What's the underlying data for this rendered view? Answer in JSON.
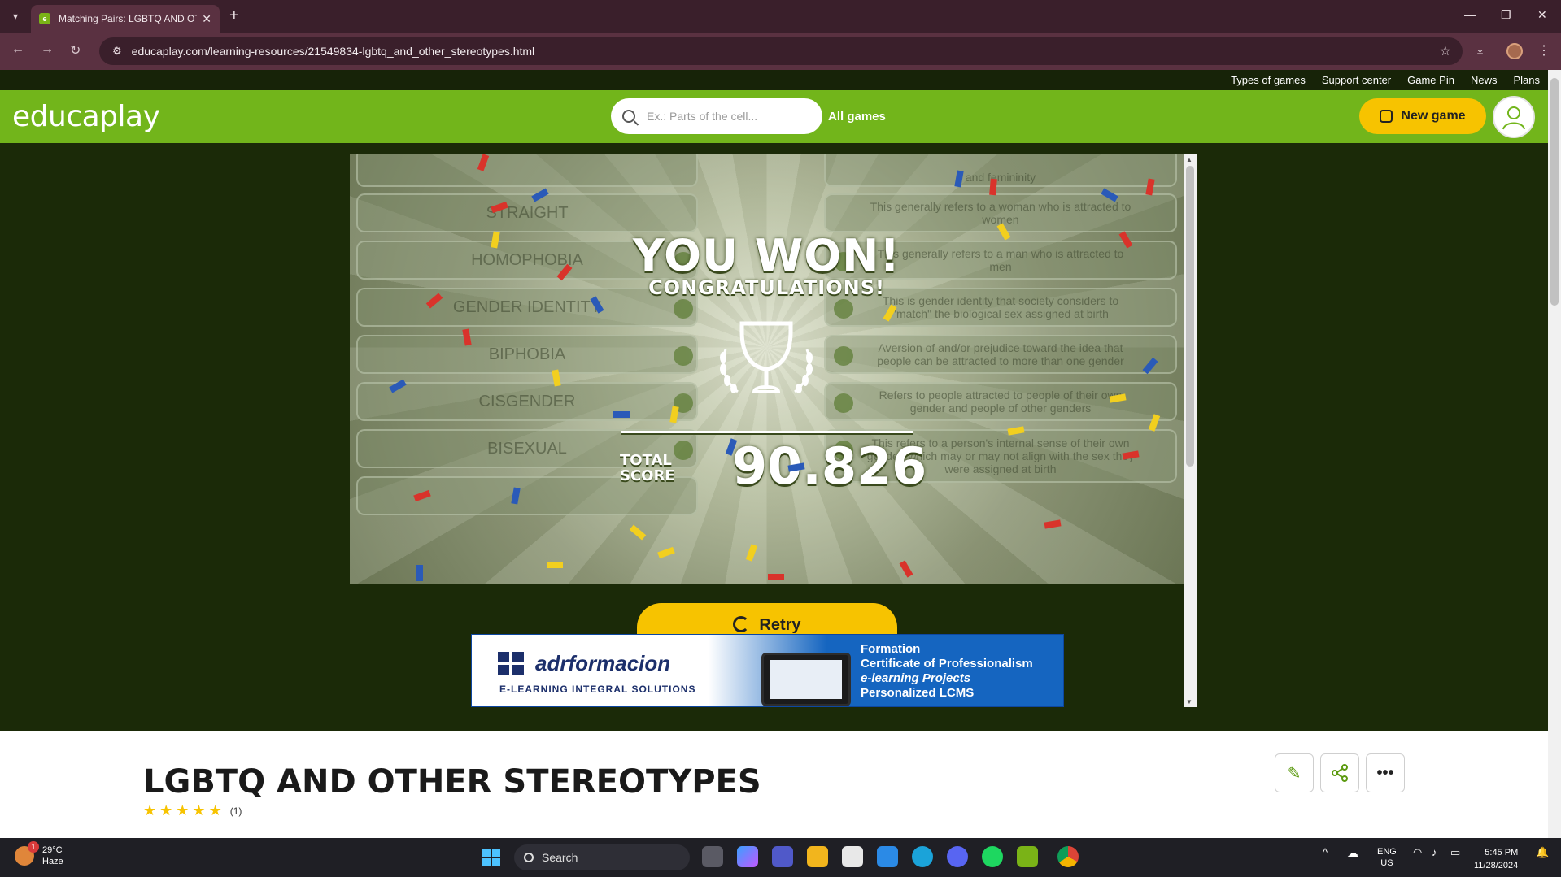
{
  "browser": {
    "tab_title": "Matching Pairs: LGBTQ AND OT",
    "url": "educaplay.com/learning-resources/21549834-lgbtq_and_other_stereotypes.html"
  },
  "topmenu": [
    "Types of games",
    "Support center",
    "Game Pin",
    "News",
    "Plans"
  ],
  "header": {
    "logo": "educaplay",
    "search_placeholder": "Ex.: Parts of the cell...",
    "all_games": "All games",
    "new_game": "New game"
  },
  "game": {
    "left_items": [
      "STRAIGHT",
      "HOMOPHOBIA",
      "GENDER IDENTITY",
      "BIPHOBIA",
      "CISGENDER",
      "BISEXUAL"
    ],
    "right_items": [
      "and femininity",
      "This generally refers to a woman who is attracted to women",
      "This generally refers to a man who is attracted to men",
      "This is gender identity that society considers to \"match\" the biological sex assigned at birth",
      "Aversion of and/or prejudice toward the idea that people can be attracted to more than one gender",
      "Refers to people attracted to people of their own gender and people of other genders",
      "This refers to a person's internal sense of their own gender, which may or may not align with the sex they were assigned at birth"
    ],
    "won_title": "YOU WON!",
    "won_subtitle": "CONGRATULATIONS!",
    "total_label_1": "TOTAL",
    "total_label_2": "SCORE",
    "score": "90.826",
    "retry": "Retry"
  },
  "ad": {
    "brand": "adrformacion",
    "tagline": "E-LEARNING   INTEGRAL   SOLUTIONS",
    "lines": [
      "Formation",
      "Certificate of Professionalism",
      "e-learning Projects",
      "Personalized LCMS"
    ]
  },
  "resource": {
    "title": "LGBTQ AND OTHER STEREOTYPES",
    "rating_count": "(1)"
  },
  "taskbar": {
    "temp": "29°C",
    "condition": "Haze",
    "weather_badge": "1",
    "search": "Search",
    "lang_1": "ENG",
    "lang_2": "US",
    "time": "5:45 PM",
    "date": "11/28/2024"
  },
  "colors": {
    "header_green": "#72b51b",
    "page_dark": "#1b2a08",
    "accent_yellow": "#f7c300",
    "browser_frame": "#5a3141"
  }
}
